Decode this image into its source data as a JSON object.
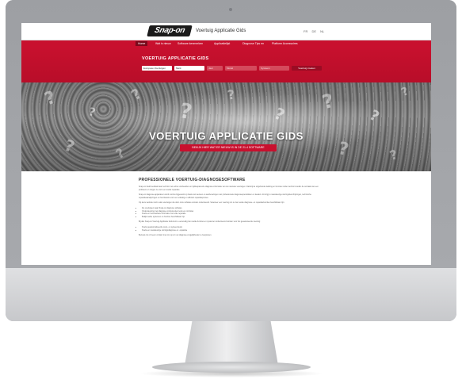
{
  "header": {
    "logo_text": "Snap-on",
    "subtitle": "Voertuig Applicatie Gids",
    "languages": [
      "FR",
      "DE",
      "NL"
    ]
  },
  "nav": {
    "items": [
      {
        "label": "Home",
        "active": true
      },
      {
        "label": "Wat is nieuw"
      },
      {
        "label": "Software kenmerken"
      },
      {
        "label": "Applicatielijst"
      },
      {
        "label": "Diagnose Tips en"
      },
      {
        "label": "Platform Accessoires"
      }
    ]
  },
  "search": {
    "title": "VOERTUIG APPLICATIE GIDS",
    "region": "Europese Voertuigen",
    "make": "Merk",
    "year": "Jaar",
    "model": "Model",
    "system": "Systeem",
    "submit_label": "Voertuig zoeken"
  },
  "hero": {
    "title": "VOERTUIG APPLICATIE GIDS",
    "button_label": "BEKIJK HIER WAT ER NIEUW IS IN DE 21.4 SOFTWARE"
  },
  "content": {
    "heading": "PROFESSIONELE VOERTUIG-DIAGNOSESOFTWARE",
    "para1": "Snap-on biedt feedback aan technici met echte voorbeelden en tijdbesparende diagnose-informatie van de nieuwste voertuigen. Dankzij de uitgebreide dekking en functies vinden technici sneller de oorzaak van een probleem en zorgen ze voor een snelle reparatie.",
    "para2": "Snap-on diagnose-apparatuur wordt continu bijgewerkt op basis van wensen en aanbevelingen van professionele diagnosespecialisten en dealers. Zo krijgt u nauwkeurige storingsbeschrijvingen, technische reparatieaanwijzingen en functietests voor een volledig en efficiënt reparatieproces.",
    "para3": "Op deze website vindt u alle voertuigen die door onze software worden ondersteund. Selecteer een voertuig om te zien welke diagnose- en reparatiefuncties beschikbaar zijn:",
    "bullets": [
      "Zie voertuigen waar Snap-on diagnose software",
      "Ondersteuning met diagnose componenten tests en controles",
      "Snelle en betrouwbare informatie voor elke reparatie",
      "Bekijk welke systemen en functies beschikbaar zijn"
    ],
    "para4": "Bij alle Snap-on Voertuig Applicatie Gids kunt u eenvoudig zien welke functies en systemen ondersteund worden voor het geselecteerde voertuig:",
    "bullets2": [
      "Snelle geautomatiseerde scan- en systeemtests",
      "Snelle en nauwkeurige storingsdiagnose en -reparatie"
    ],
    "para5": "Bezoek ons of neem contact met ons op om uw diagnose-mogelijkheden te bespreken."
  }
}
